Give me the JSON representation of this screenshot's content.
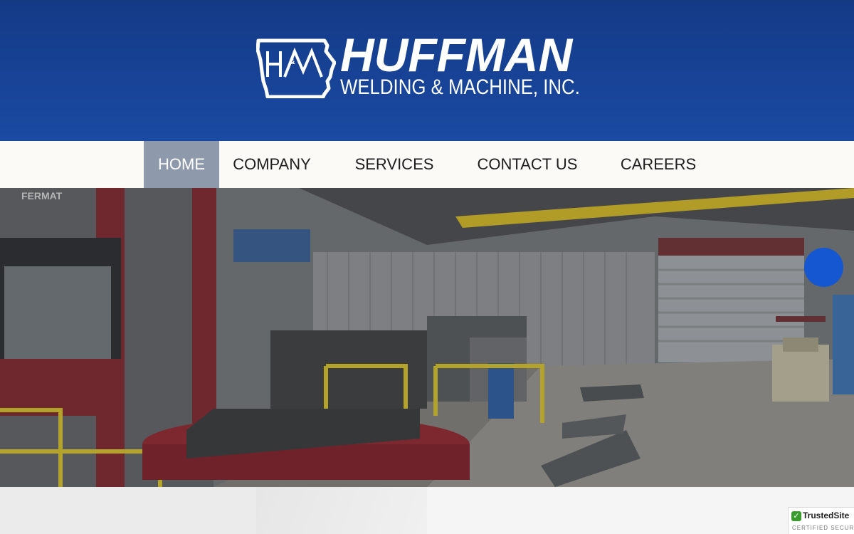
{
  "brand": {
    "name": "HUFFMAN",
    "tagline": "WELDING & MACHINE, INC.",
    "mark_letters": "H&M",
    "header_color": "#143a86"
  },
  "nav": {
    "items": [
      {
        "label": "HOME",
        "active": true
      },
      {
        "label": "COMPANY",
        "active": false
      },
      {
        "label": "SERVICES",
        "active": false
      },
      {
        "label": "CONTACT US",
        "active": false
      },
      {
        "label": "CAREERS",
        "active": false
      }
    ],
    "active_color": "#8e9aab"
  },
  "hero": {
    "image": "machine-shop-floor-photo",
    "machine_text": "FERMAT"
  },
  "chat": {
    "icon": "chat-bubble-icon",
    "color": "#1557d0"
  },
  "trust_badge": {
    "title": "TrustedSite",
    "subtitle": "CERTIFIED SECURE"
  }
}
